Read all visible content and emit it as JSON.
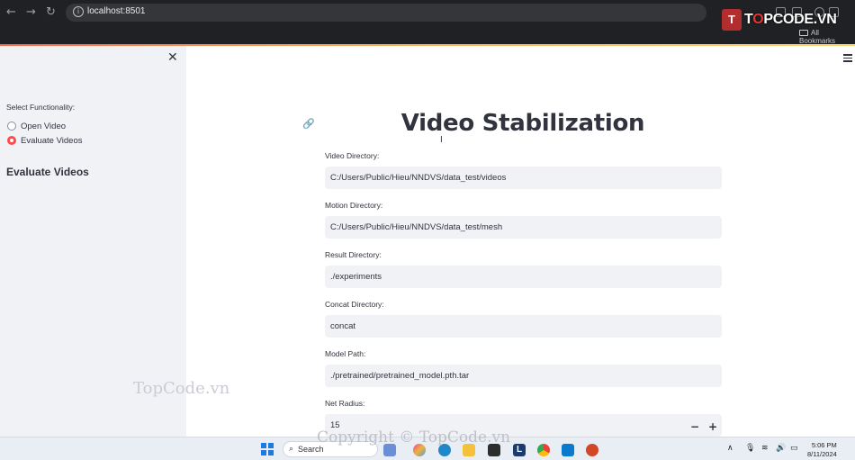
{
  "browser": {
    "url": "localhost:8501",
    "bookmarks_label": "All Bookmarks"
  },
  "sidebar": {
    "select_label": "Select Functionality:",
    "options": [
      {
        "label": "Open Video",
        "selected": false
      },
      {
        "label": "Evaluate Videos",
        "selected": true
      }
    ],
    "section_heading": "Evaluate Videos"
  },
  "main": {
    "title": "Video Stabilization",
    "fields": [
      {
        "label": "Video Directory:",
        "value": "C:/Users/Public/Hieu/NNDVS/data_test/videos"
      },
      {
        "label": "Motion Directory:",
        "value": "C:/Users/Public/Hieu/NNDVS/data_test/mesh"
      },
      {
        "label": "Result Directory:",
        "value": "./experiments"
      },
      {
        "label": "Concat Directory:",
        "value": "concat"
      },
      {
        "label": "Model Path:",
        "value": "./pretrained/pretrained_model.pth.tar"
      },
      {
        "label": "Net Radius:",
        "value": "15"
      }
    ],
    "stepper_minus": "−",
    "stepper_plus": "+"
  },
  "watermarks": {
    "logo_badge": "T",
    "logo_text_1": "T",
    "logo_text_o": "O",
    "logo_text_2": "PCODE.VN",
    "side": "TopCode.vn",
    "copyright": "Copyright © TopCode.vn"
  },
  "taskbar": {
    "search_label": "Search",
    "time": "5:06 PM",
    "date": "8/11/2024"
  },
  "colors": {
    "accent": "#ff4b4b",
    "sidebar_bg": "#f0f2f6",
    "input_bg": "#f0f2f6",
    "text": "#31333f"
  }
}
